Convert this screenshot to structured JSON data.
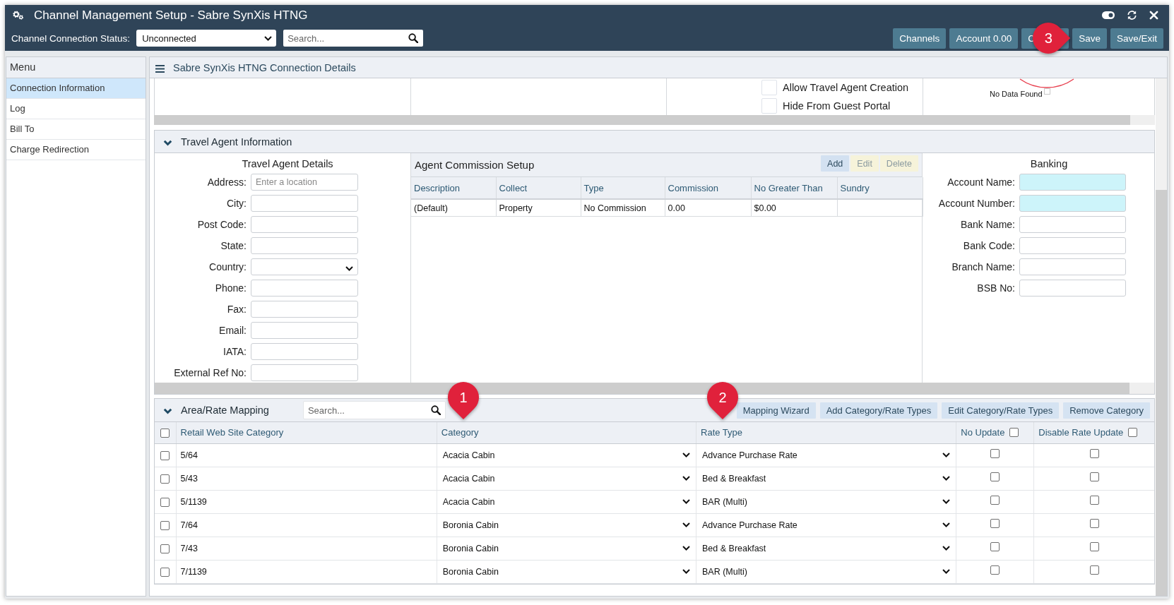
{
  "window": {
    "title": "Channel Management Setup - Sabre SynXis HTNG"
  },
  "toolbar": {
    "status": {
      "label": "Channel Connection Status:",
      "value": "Unconnected"
    },
    "search": {
      "placeholder": "Search..."
    },
    "buttons": [
      {
        "label": "Channels"
      },
      {
        "label": "Account 0.00"
      },
      {
        "label": "C"
      },
      {
        "label": "Save",
        "callout": "3"
      },
      {
        "label": "Save/Exit"
      }
    ]
  },
  "sidebar": {
    "title": "Menu",
    "items": [
      {
        "label": "Connection Information",
        "selected": true
      },
      {
        "label": "Log",
        "selected": false
      },
      {
        "label": "Bill To",
        "selected": false
      },
      {
        "label": "Charge Redirection",
        "selected": false
      }
    ]
  },
  "panel": {
    "title": "Sabre SynXis HTNG Connection Details",
    "connection": {
      "options": [
        {
          "label": "Allow Travel Agent Creation",
          "checked": false
        },
        {
          "label": "Hide From Guest Portal",
          "checked": false
        }
      ],
      "chart_message": "No Data Found"
    },
    "travel_agent": {
      "title": "Travel Agent Information",
      "expanded": true,
      "details": {
        "title": "Travel Agent Details",
        "fields": [
          {
            "label": "Address:",
            "kind": "text",
            "placeholder": "Enter a location"
          },
          {
            "label": "City:",
            "kind": "text"
          },
          {
            "label": "Post Code:",
            "kind": "text"
          },
          {
            "label": "State:",
            "kind": "text"
          },
          {
            "label": "Country:",
            "kind": "select"
          },
          {
            "label": "Phone:",
            "kind": "text"
          },
          {
            "label": "Fax:",
            "kind": "text"
          },
          {
            "label": "Email:",
            "kind": "text"
          },
          {
            "label": "IATA:",
            "kind": "text"
          },
          {
            "label": "External Ref No:",
            "kind": "text"
          }
        ]
      },
      "commission": {
        "title": "Agent Commission Setup",
        "actions": [
          {
            "label": "Add",
            "disabled": false
          },
          {
            "label": "Edit",
            "disabled": true
          },
          {
            "label": "Delete",
            "disabled": true
          }
        ],
        "columns": [
          "Description",
          "Collect",
          "Type",
          "Commission",
          "No Greater Than",
          "Sundry"
        ],
        "rows": [
          {
            "cells": [
              "(Default)",
              "Property",
              "No Commission",
              "0.00",
              "$0.00"
            ]
          }
        ]
      },
      "banking": {
        "title": "Banking",
        "fields": [
          {
            "label": "Account Name:",
            "required": true
          },
          {
            "label": "Account Number:",
            "required": true
          },
          {
            "label": "Bank Name:",
            "required": false
          },
          {
            "label": "Bank Code:",
            "required": false
          },
          {
            "label": "Branch Name:",
            "required": false
          },
          {
            "label": "BSB No:",
            "required": false
          }
        ]
      }
    },
    "mapping": {
      "title": "Area/Rate Mapping",
      "expanded": true,
      "search": {
        "placeholder": "Search..."
      },
      "actions": [
        "Mapping Wizard",
        "Add Category/Rate Types",
        "Edit Category/Rate Types",
        "Remove Category"
      ],
      "select_all": false,
      "columns": [
        {
          "label": "Retail Web Site Category",
          "kind": "text"
        },
        {
          "label": "Category",
          "kind": "dropdown",
          "callout": "1"
        },
        {
          "label": "Rate Type",
          "kind": "dropdown",
          "callout": "2"
        },
        {
          "label": "No Update",
          "kind": "checkbox",
          "checked": false
        },
        {
          "label": "Disable Rate Update",
          "kind": "checkbox",
          "checked": false
        }
      ],
      "rows": [
        {
          "selected": false,
          "cells": [
            "5/64",
            "Acacia Cabin",
            "Advance Purchase Rate",
            false,
            false
          ]
        },
        {
          "selected": false,
          "cells": [
            "5/43",
            "Acacia Cabin",
            "Bed & Breakfast",
            false,
            false
          ]
        },
        {
          "selected": false,
          "cells": [
            "5/1139",
            "Acacia Cabin",
            "BAR (Multi)",
            false,
            false
          ]
        },
        {
          "selected": false,
          "cells": [
            "7/64",
            "Boronia Cabin",
            "Advance Purchase Rate",
            false,
            false
          ]
        },
        {
          "selected": false,
          "cells": [
            "7/43",
            "Boronia Cabin",
            "Bed & Breakfast",
            false,
            false
          ]
        },
        {
          "selected": false,
          "cells": [
            "7/1139",
            "Boronia Cabin",
            "BAR (Multi)",
            false,
            false
          ]
        }
      ]
    }
  }
}
